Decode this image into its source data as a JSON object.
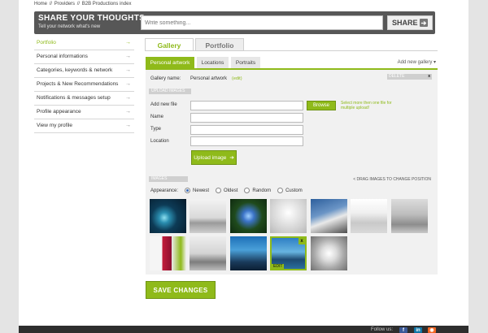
{
  "breadcrumb": [
    "Home",
    "//",
    "Providers",
    "//",
    "B2B Productions index"
  ],
  "share": {
    "title": "SHARE YOUR THOUGHTS",
    "subtitle": "Tell your network what's new",
    "placeholder": "Write something...",
    "button": "SHARE"
  },
  "sidebar": {
    "items": [
      {
        "label": "Portfolio",
        "active": true
      },
      {
        "label": "Personal informations"
      },
      {
        "label": "Categories, keywords & network"
      },
      {
        "label": "Projects & New Recommendations"
      },
      {
        "label": "Notifications & messages setup"
      },
      {
        "label": "Profile appearance"
      },
      {
        "label": "View my profile"
      }
    ]
  },
  "main_tabs": [
    {
      "label": "Gallery"
    },
    {
      "label": "Portfolio"
    }
  ],
  "sub_tabs": [
    {
      "label": "Personal artwork"
    },
    {
      "label": "Locations"
    },
    {
      "label": "Portraits"
    }
  ],
  "add_gallery": "Add new gallery ▾",
  "gallery": {
    "name_label": "Gallery name:",
    "name_value": "Personal artwork",
    "edit_label": "(edit)",
    "delete_label": "DELETE",
    "delete_x": "x"
  },
  "upload": {
    "header": "UPLOAD IMAGES",
    "fields": [
      "Add new file",
      "Name",
      "Type",
      "Location"
    ],
    "browse": "Browse",
    "browse_hint": "Select more then one file for multiple upload!",
    "upload_button": "Upload image"
  },
  "images": {
    "header": "IMAGES",
    "drag_hint": "< DRAG IMAGES TO CHANGE POSITION",
    "appearance_label": "Appearance:",
    "options": [
      "Newest",
      "Oldest",
      "Random",
      "Custom"
    ],
    "selected_option": "Newest",
    "edit_label": "EDIT",
    "remove_x": "x"
  },
  "save_button": "SAVE CHANGES",
  "footer": {
    "follow_label": "Follow us:",
    "icons": [
      "facebook-icon",
      "linkedin-icon",
      "rss-icon"
    ]
  },
  "colors": {
    "accent": "#8fba1a",
    "header": "#575757",
    "footer": "#2e2e2e"
  }
}
